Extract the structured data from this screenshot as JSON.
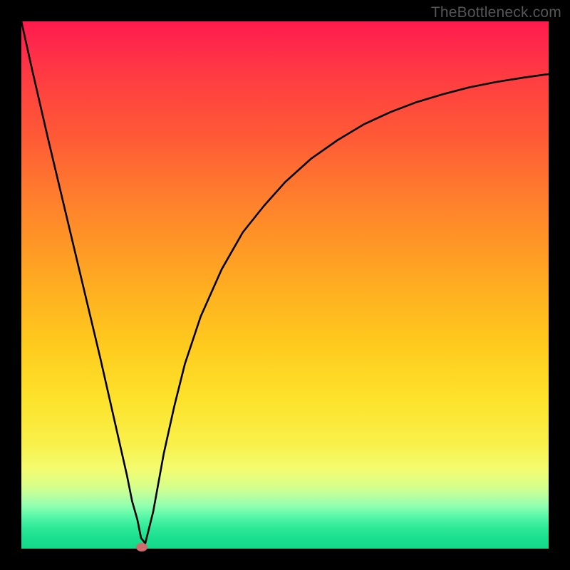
{
  "watermark": "TheBottleneck.com",
  "chart_data": {
    "type": "line",
    "title": "",
    "xlabel": "",
    "ylabel": "",
    "xlim": [
      0,
      100
    ],
    "ylim": [
      0,
      100
    ],
    "series": [
      {
        "name": "curve",
        "x": [
          0,
          2,
          5,
          10,
          15,
          20,
          21,
          22,
          22.7,
          23.5,
          25,
          27,
          29,
          31,
          34,
          38,
          42,
          46,
          50,
          55,
          60,
          65,
          70,
          75,
          80,
          85,
          90,
          95,
          100
        ],
        "values": [
          100,
          91,
          78,
          57,
          36,
          14,
          9,
          5.5,
          2,
          1,
          7,
          18,
          27,
          35,
          44,
          53,
          60,
          65,
          69.5,
          74,
          77.5,
          80.5,
          82.8,
          84.7,
          86.2,
          87.5,
          88.5,
          89.3,
          90
        ]
      }
    ],
    "marker": {
      "x": 22.9,
      "y": 0.3
    },
    "colors": {
      "curve": "#000000",
      "marker": "#d26b6b"
    }
  }
}
